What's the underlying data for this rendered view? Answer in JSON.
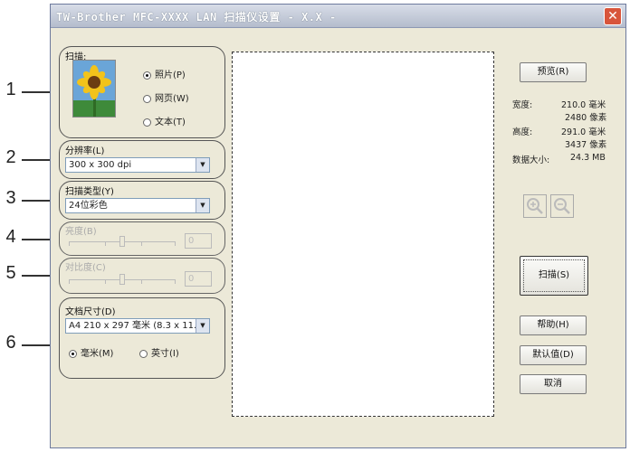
{
  "window": {
    "title": "TW-Brother MFC-XXXX LAN 扫描仪设置 - X.X -",
    "close_glyph": "✕"
  },
  "callouts": [
    "1",
    "2",
    "3",
    "4",
    "5",
    "6"
  ],
  "scan_group": {
    "label": "扫描:",
    "options": [
      {
        "label": "照片(P)",
        "selected": true
      },
      {
        "label": "网页(W)",
        "selected": false
      },
      {
        "label": "文本(T)",
        "selected": false
      }
    ]
  },
  "resolution": {
    "label": "分辨率(L)",
    "value": "300 x 300 dpi"
  },
  "scan_type": {
    "label": "扫描类型(Y)",
    "value": "24位彩色"
  },
  "brightness": {
    "label": "亮度(B)",
    "value": "0"
  },
  "contrast": {
    "label": "对比度(C)",
    "value": "0"
  },
  "doc_size": {
    "label": "文档尺寸(D)",
    "value": "A4 210 x 297 毫米 (8.3 x 11.",
    "units": [
      {
        "label": "毫米(M)",
        "selected": true
      },
      {
        "label": "英寸(I)",
        "selected": false
      }
    ]
  },
  "buttons": {
    "preview": "预览(R)",
    "scan": "扫描(S)",
    "help": "帮助(H)",
    "default": "默认值(D)",
    "cancel": "取消"
  },
  "info": {
    "width_label": "宽度:",
    "width_mm": "210.0 毫米",
    "width_px": "2480 像素",
    "height_label": "高度:",
    "height_mm": "291.0 毫米",
    "height_px": "3437 像素",
    "size_label": "数据大小:",
    "size_value": "24.3 MB"
  },
  "colors": {
    "accent": "#d8553b",
    "window_bg": "#ece9d8"
  }
}
